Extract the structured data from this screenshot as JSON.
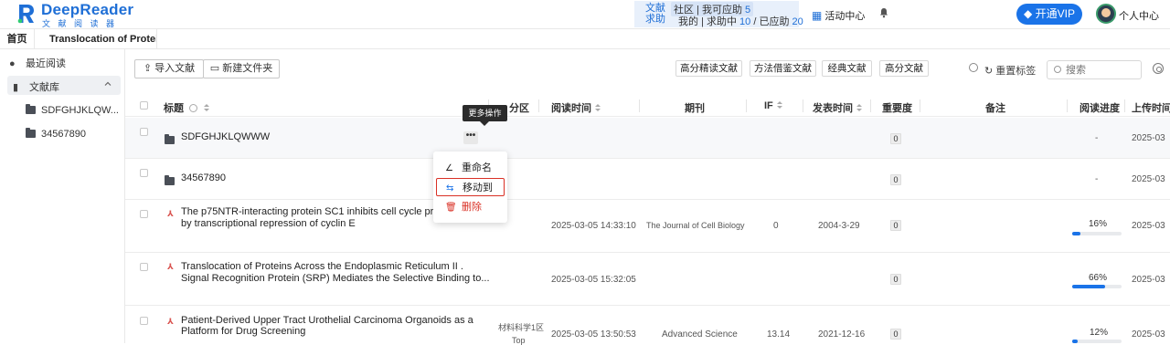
{
  "app": {
    "name": "DeepReader",
    "subtitle": "文献阅读器"
  },
  "header": {
    "help_tag": "文献求助",
    "help_line1_text": "社区 | 我可应助",
    "help_line1_count": "5",
    "help_mine_label": "我的 | 求助中",
    "help_pending_count": "10",
    "help_sep": "/ 已应助",
    "help_done_count": "20",
    "activity_label": "活动中心",
    "vip_label": "开通VIP",
    "user_center_label": "个人中心"
  },
  "tabs": {
    "home": "首页",
    "doc": "Translocation of Protei"
  },
  "sidebar": {
    "recent": "最近阅读",
    "library": "文献库",
    "folders": [
      "SDFGHJKLQW...",
      "34567890"
    ]
  },
  "toolbar": {
    "import": "导入文献",
    "new_folder": "新建文件夹",
    "filters": [
      "高分精读文献",
      "方法借鉴文献",
      "经典文献",
      "高分文献"
    ],
    "reset_tags": "重置标签",
    "search_placeholder": "搜索"
  },
  "table": {
    "headers": {
      "title": "标题",
      "zone": "分区",
      "read_time": "阅读时间",
      "journal": "期刊",
      "if": "IF",
      "pub_time": "发表时间",
      "importance": "重要度",
      "note": "备注",
      "progress": "阅读进度",
      "upload_time": "上传时间"
    },
    "rows": [
      {
        "type": "folder",
        "title": "SDFGHJKLQWWW",
        "importance": "0",
        "progress_text": "-",
        "upload": "2025-03"
      },
      {
        "type": "folder",
        "title": "34567890",
        "importance": "0",
        "progress_text": "-",
        "upload": "2025-03"
      },
      {
        "type": "pdf",
        "title1": "The p75NTR-interacting protein SC1 inhibits cell cycle progress",
        "title2": "by transcriptional repression of cyclin E",
        "read_time": "2025-03-05 14:33:10",
        "journal": "The Journal of Cell Biology",
        "if": "0",
        "pub_time": "2004-3-29",
        "importance": "0",
        "progress": 0.16,
        "progress_text": "16%",
        "upload": "2025-03"
      },
      {
        "type": "pdf",
        "title1": "Translocation of Proteins Across the Endoplasmic Reticulum II .",
        "title2": "Signal Recognition Protein (SRP) Mediates the Selective Binding to...",
        "read_time": "2025-03-05 15:32:05",
        "importance": "0",
        "progress": 0.66,
        "progress_text": "66%",
        "upload": "2025-03"
      },
      {
        "type": "pdf",
        "title1": "Patient-Derived Upper Tract Urothelial Carcinoma Organoids as a",
        "title2": "Platform for Drug Screening",
        "zone1": "材料科学1区",
        "zone2": "Top",
        "read_time": "2025-03-05 13:50:53",
        "journal": "Advanced Science",
        "if": "13.14",
        "pub_time": "2021-12-16",
        "importance": "0",
        "progress": 0.12,
        "progress_text": "12%",
        "upload": "2025-03"
      }
    ]
  },
  "tooltip": "更多操作",
  "more_glyph": "•••",
  "context_menu": {
    "rename": "重命名",
    "move_to": "移动到",
    "delete": "删除"
  },
  "colors": {
    "brand": "#1f6fd6",
    "primary": "#1a73e8",
    "danger": "#d93025"
  }
}
